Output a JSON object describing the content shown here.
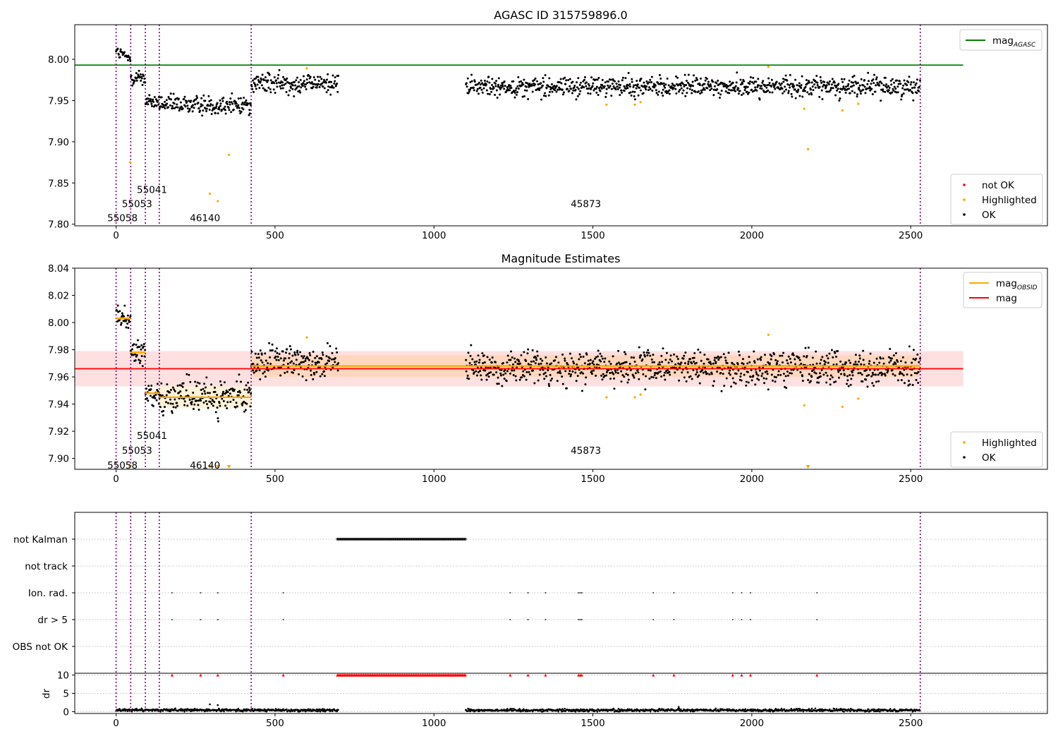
{
  "chart_data": [
    {
      "type": "scatter",
      "title": "AGASC ID 315759896.0",
      "xlim": [
        -130,
        2930
      ],
      "ylim": [
        7.798,
        8.042
      ],
      "x_ticks": [
        0,
        500,
        1000,
        1500,
        2000,
        2500
      ],
      "y_ticks": [
        7.8,
        7.85,
        7.9,
        7.95,
        8.0
      ],
      "reference_line": {
        "label": "mag_AGASC",
        "value": 7.993,
        "x_range": [
          -130,
          2665
        ],
        "color": "#008000"
      },
      "obsid_boundaries": [
        0,
        46,
        92,
        136,
        425,
        2530
      ],
      "obsid_labels": [
        {
          "text": "55058",
          "x": 20,
          "y": 7.808
        },
        {
          "text": "55053",
          "x": 66,
          "y": 7.825
        },
        {
          "text": "55041",
          "x": 113,
          "y": 7.842
        },
        {
          "text": "46140",
          "x": 280,
          "y": 7.808
        },
        {
          "text": "45873",
          "x": 1478,
          "y": 7.825
        }
      ],
      "segments": [
        {
          "x_range": [
            0,
            46
          ],
          "mean": 8.004,
          "trend": -0.01,
          "spread": 0.004
        },
        {
          "x_range": [
            46,
            92
          ],
          "mean": 7.978,
          "trend": 0.0,
          "spread": 0.005
        },
        {
          "x_range": [
            92,
            136
          ],
          "mean": 7.948,
          "trend": 0.0,
          "spread": 0.004
        },
        {
          "x_range": [
            136,
            425
          ],
          "mean": 7.945,
          "trend": 0.0,
          "spread": 0.006
        },
        {
          "x_range": [
            425,
            700
          ],
          "mean": 7.971,
          "trend": 0.0,
          "spread": 0.006
        },
        {
          "x_range": [
            1100,
            2530
          ],
          "mean": 7.967,
          "trend": 0.0,
          "spread": 0.006
        }
      ],
      "highlighted": [
        {
          "x": 44,
          "y": 7.875
        },
        {
          "x": 295,
          "y": 7.837
        },
        {
          "x": 320,
          "y": 7.828
        },
        {
          "x": 355,
          "y": 7.884
        },
        {
          "x": 600,
          "y": 7.989
        },
        {
          "x": 1543,
          "y": 7.945
        },
        {
          "x": 1632,
          "y": 7.945
        },
        {
          "x": 1650,
          "y": 7.948
        },
        {
          "x": 2052,
          "y": 7.991
        },
        {
          "x": 2165,
          "y": 7.94
        },
        {
          "x": 2177,
          "y": 7.891
        },
        {
          "x": 2285,
          "y": 7.938
        },
        {
          "x": 2335,
          "y": 7.946
        }
      ],
      "legend_top": [
        {
          "label": "mag",
          "sub": "AGASC",
          "color": "#008000"
        }
      ],
      "legend_bottom": [
        {
          "label": "not OK",
          "color": "#ff0000"
        },
        {
          "label": "Highlighted",
          "color": "#ffa500"
        },
        {
          "label": "OK",
          "color": "#000000"
        }
      ]
    },
    {
      "type": "scatter",
      "title": "Magnitude Estimates",
      "xlim": [
        -130,
        2930
      ],
      "ylim": [
        7.892,
        8.04
      ],
      "x_ticks": [
        0,
        500,
        1000,
        1500,
        2000,
        2500
      ],
      "y_ticks": [
        7.9,
        7.92,
        7.94,
        7.96,
        7.98,
        8.0,
        8.02,
        8.04
      ],
      "mag_line": {
        "label": "mag",
        "value": 7.966,
        "band": [
          7.953,
          7.979
        ],
        "x_range": [
          -130,
          2665
        ],
        "color": "#ff0000"
      },
      "obsid_mag": [
        {
          "x_range": [
            0,
            46
          ],
          "value": 8.003,
          "err": 0.002
        },
        {
          "x_range": [
            46,
            92
          ],
          "value": 7.978,
          "err": 0.002
        },
        {
          "x_range": [
            92,
            136
          ],
          "value": 7.948,
          "err": 0.002
        },
        {
          "x_range": [
            136,
            425
          ],
          "value": 7.945,
          "err": 0.008
        },
        {
          "x_range": [
            425,
            2530
          ],
          "value": 7.968,
          "err": 0.008
        }
      ],
      "obsid_boundaries": [
        0,
        46,
        92,
        136,
        425,
        2530
      ],
      "obsid_labels": [
        {
          "text": "55058",
          "x": 20,
          "y": 7.895
        },
        {
          "text": "55053",
          "x": 66,
          "y": 7.906
        },
        {
          "text": "55041",
          "x": 113,
          "y": 7.917
        },
        {
          "text": "46140",
          "x": 280,
          "y": 7.895
        },
        {
          "text": "45873",
          "x": 1478,
          "y": 7.906
        }
      ],
      "highlighted": [
        {
          "x": 600,
          "y": 7.989
        },
        {
          "x": 1543,
          "y": 7.945
        },
        {
          "x": 1632,
          "y": 7.945
        },
        {
          "x": 1650,
          "y": 7.947
        },
        {
          "x": 2052,
          "y": 7.991
        },
        {
          "x": 2165,
          "y": 7.939
        },
        {
          "x": 2285,
          "y": 7.938
        },
        {
          "x": 2335,
          "y": 7.944
        }
      ],
      "out_of_range_markers": [
        44,
        295,
        320,
        355,
        2177
      ],
      "legend_top": [
        {
          "label": "mag",
          "sub": "OBSID",
          "color": "#ffa500"
        },
        {
          "label": "mag",
          "sub": "",
          "color": "#ff0000"
        }
      ],
      "legend_bottom": [
        {
          "label": "Highlighted",
          "color": "#ffa500"
        },
        {
          "label": "OK",
          "color": "#000000"
        }
      ]
    },
    {
      "type": "scatter",
      "title": "",
      "xlim": [
        -130,
        2930
      ],
      "x_ticks": [
        0,
        500,
        1000,
        1500,
        2000,
        2500
      ],
      "flag_rows": [
        "not Kalman",
        "not track",
        "Ion. rad.",
        "dr > 5",
        "OBS not OK"
      ],
      "flag_events": [
        176,
        266,
        320,
        526,
        1240,
        1296,
        1351,
        1455,
        1460,
        1465,
        1690,
        1755,
        1940,
        1968,
        1996,
        2205
      ],
      "not_kalman_range": [
        696,
        1100
      ],
      "obsid_boundaries": [
        0,
        46,
        92,
        136,
        425,
        2530
      ],
      "dr": {
        "ylabel": "dr",
        "y_ticks": [
          0,
          5,
          10
        ],
        "ylim": [
          -0.5,
          10.5
        ],
        "clip_value": 10,
        "typical": 0.4,
        "outliers": [
          {
            "x": 295,
            "y": 2.0
          },
          {
            "x": 320,
            "y": 1.8
          },
          {
            "x": 1770,
            "y": 1.3
          }
        ]
      }
    }
  ]
}
